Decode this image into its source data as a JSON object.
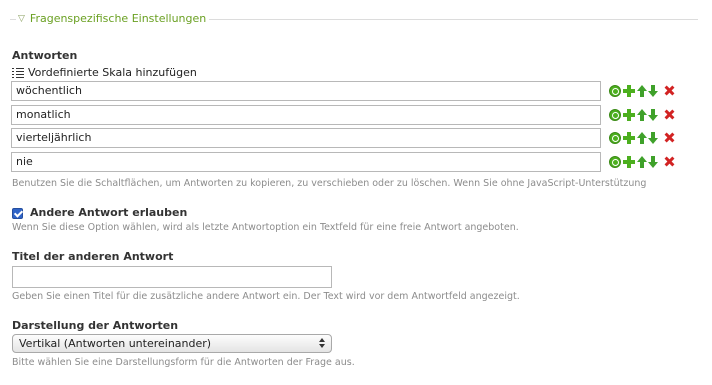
{
  "section": {
    "legend": "Fragenspezifische Einstellungen"
  },
  "answers": {
    "label": "Antworten",
    "scale_link": "Vordefinierte Skala hinzufügen",
    "items": [
      "wöchentlich",
      "monatlich",
      "vierteljährlich",
      "nie"
    ],
    "help": "Benutzen Sie die Schaltflächen, um Antworten zu kopieren, zu verschieben oder zu löschen. Wenn Sie ohne JavaScript-Unterstützung"
  },
  "other": {
    "checkbox_label": "Andere Antwort erlauben",
    "checked": true,
    "help": "Wenn Sie diese Option wählen, wird als letzte Antwortoption ein Textfeld für eine freie Antwort angeboten."
  },
  "other_title": {
    "label": "Titel der anderen Antwort",
    "value": "",
    "help": "Geben Sie einen Titel für die zusätzliche andere Antwort ein. Der Text wird vor dem Antwortfeld angezeigt."
  },
  "display": {
    "label": "Darstellung der Antworten",
    "selected": "Vertikal (Antworten untereinander)",
    "help": "Bitte wählen Sie eine Darstellungsform für die Antworten der Frage aus."
  },
  "icons": {
    "legend": "triangle-down-icon",
    "scale": "list-icon",
    "copy": "copy-icon",
    "add": "plus-icon",
    "up": "arrow-up-icon",
    "down": "arrow-down-icon",
    "delete": "delete-icon"
  },
  "colors": {
    "legend": "#6aa022",
    "green": "#4caf1e",
    "delete": "#d22323",
    "checkbox": "#2f64c8"
  }
}
